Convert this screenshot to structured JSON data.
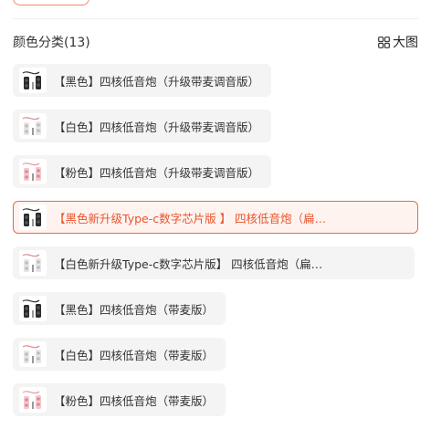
{
  "header": {
    "title": "颜色分类(13)",
    "view_toggle_label": "大图",
    "view_toggle_icon": "grid-icon"
  },
  "colors": {
    "accent": "#ea6a45",
    "selected_bg": "#fff3ef",
    "chip_bg": "#f4f4f4"
  },
  "options": [
    {
      "label": "【黑色】四核低音炮（升级带麦调音版）",
      "selected": false,
      "speaker": "black"
    },
    {
      "label": "【白色】四核低音炮（升级带麦调音版）",
      "selected": false,
      "speaker": "white"
    },
    {
      "label": "【粉色】四核低音炮（升级带麦调音版）",
      "selected": false,
      "speaker": "pink"
    },
    {
      "label": "【黑色新升级Type-c数字芯片版 】 四核低音炮（扁…",
      "selected": true,
      "speaker": "black"
    },
    {
      "label": "【白色新升级Type-c数字芯片版】  四核低音炮（扁…",
      "selected": false,
      "speaker": "white"
    },
    {
      "label": "【黑色】四核低音炮（带麦版）",
      "selected": false,
      "speaker": "black"
    },
    {
      "label": "【白色】四核低音炮（带麦版）",
      "selected": false,
      "speaker": "white"
    },
    {
      "label": "【粉色】四核低音炮（带麦版）",
      "selected": false,
      "speaker": "pink"
    }
  ]
}
